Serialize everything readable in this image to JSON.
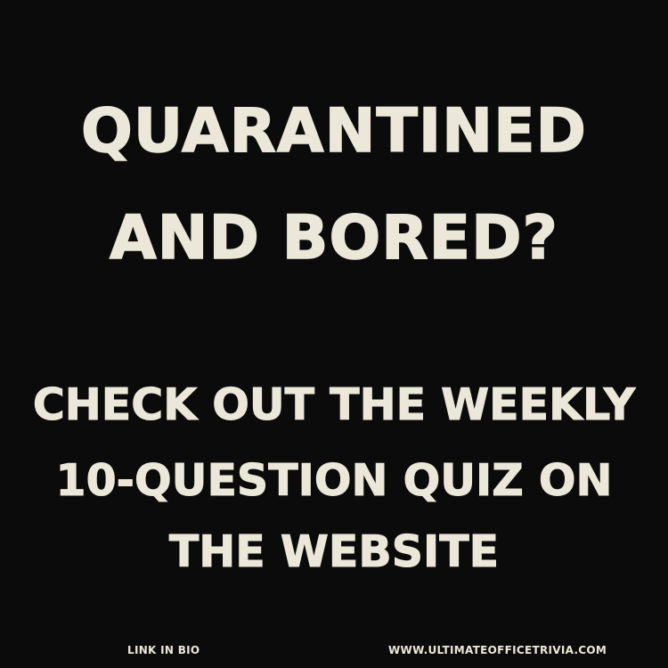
{
  "headline": {
    "line1": "QUARANTINED",
    "line2": "AND BORED?"
  },
  "subhead": {
    "line1": "CHECK OUT THE WEEKLY",
    "line2": "10-QUESTION QUIZ ON",
    "line3": "THE WEBSITE"
  },
  "footer": {
    "left": "LINK IN BIO",
    "right": "WWW.ULTIMATEOFFICETRIVIA.COM"
  },
  "colors": {
    "background": "#0b0b0b",
    "text": "#ece8d9"
  }
}
